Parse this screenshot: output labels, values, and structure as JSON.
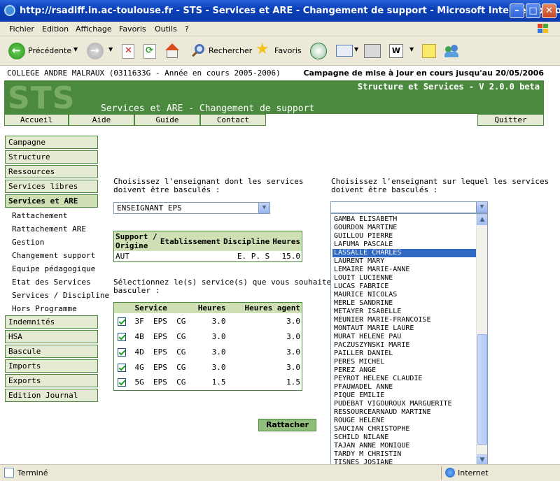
{
  "window": {
    "title": "http://rsadiff.in.ac-toulouse.fr - STS - Services et ARE - Changement de support - Microsoft Internet Explorer",
    "minimize": "–",
    "maximize": "□",
    "close": "✕"
  },
  "menu": [
    "Fichier",
    "Edition",
    "Affichage",
    "Favoris",
    "Outils",
    "?"
  ],
  "toolbar": {
    "back_label": "Précédente",
    "search_label": "Rechercher",
    "favorites_label": "Favoris"
  },
  "header": {
    "college": "COLLEGE ANDRE MALRAUX (0311633G - Année en cours 2005-2006)",
    "campagne": "Campagne de mise à jour en cours jusqu'au 20/05/2006",
    "logo": "STS",
    "version": "Structure et Services - V 2.0.0 beta",
    "page_title": "Services et ARE - Changement de support"
  },
  "nav": {
    "accueil": "Accueil",
    "aide": "Aide",
    "guide": "Guide",
    "contact": "Contact",
    "quitter": "Quitter"
  },
  "sidebar": {
    "campagne": "Campagne",
    "structure": "Structure",
    "ressources": "Ressources",
    "services_libres": "Services libres",
    "services_are": "Services et ARE",
    "sub": {
      "rattachement": "Rattachement",
      "rattachement_are": "Rattachement ARE",
      "gestion": "Gestion",
      "changement_support": "Changement support",
      "equipe": "Equipe pédagogique",
      "etat": "Etat des Services",
      "services_discipline": "Services / Discipline",
      "hors_programme": "Hors Programme"
    },
    "indemnites": "Indemnités",
    "hsa": "HSA",
    "bascule": "Bascule",
    "imports": "Imports",
    "exports": "Exports",
    "edition_journal": "Edition Journal"
  },
  "source": {
    "prompt_line1": "Choisissez l'enseignant dont les services",
    "prompt_line2": "doivent être basculés :",
    "selected": "ENSEIGNANT EPS"
  },
  "support_table": {
    "headers": [
      "Support / Origine",
      "Etablissement",
      "Discipline",
      "Heures"
    ],
    "row": {
      "support": "AUT",
      "etablissement": "",
      "discipline": "E. P. S",
      "heures": "15.0"
    }
  },
  "services": {
    "prompt_line1": "Sélectionnez le(s) service(s) que vous souhaitez",
    "prompt_line2": "basculer :",
    "headers": [
      "Service",
      "Heures",
      "Heures agent"
    ],
    "rows": [
      {
        "service": "3F  EPS  CG",
        "heures": "3.0",
        "heures_agent": "3.0"
      },
      {
        "service": "4B  EPS  CG",
        "heures": "3.0",
        "heures_agent": "3.0"
      },
      {
        "service": "4D  EPS  CG",
        "heures": "3.0",
        "heures_agent": "3.0"
      },
      {
        "service": "4G  EPS  CG",
        "heures": "3.0",
        "heures_agent": "3.0"
      },
      {
        "service": "5G  EPS  CG",
        "heures": "1.5",
        "heures_agent": "1.5"
      }
    ],
    "rattacher_label": "Rattacher"
  },
  "target": {
    "prompt_line1": "Choisissez l'enseignant sur lequel les services",
    "prompt_line2": "doivent être basculés :",
    "selected_value": "",
    "selected_index": 4,
    "options": [
      "GAMBA ELISABETH",
      "GOURDON MARTINE",
      "GUILLOU PIERRE",
      "LAFUMA PASCALE",
      "LASSALLE CHARLES",
      "LAURENT MARY",
      "LEMAIRE MARIE-ANNE",
      "LOUIT LUCIENNE",
      "LUCAS FABRICE",
      "MAURICE NICOLAS",
      "MERLE SANDRINE",
      "METAYER ISABELLE",
      "MEUNIER MARIE-FRANCOISE",
      "MONTAUT MARIE LAURE",
      "MURAT HELENE PAU",
      "PACZUSZYNSKI MARIE",
      "PAILLER DANIEL",
      "PERES MICHEL",
      "PEREZ ANGE",
      "PEYROT HELENE CLAUDIE",
      "PFAUWADEL ANNE",
      "PIQUE EMILIE",
      "PUDEBAT VIGOUROUX MARGUERITE",
      "RESSOURCEARNAUD MARTINE",
      "ROUGE HELENE",
      "SAUCIAN CHRISTOPHE",
      "SCHILD NILANE",
      "TAJAN ANNE MONIQUE",
      "TARDY M CHRISTIN",
      "TISNES JOSIANE"
    ]
  },
  "status": {
    "left": "Terminé",
    "right": "Internet"
  }
}
